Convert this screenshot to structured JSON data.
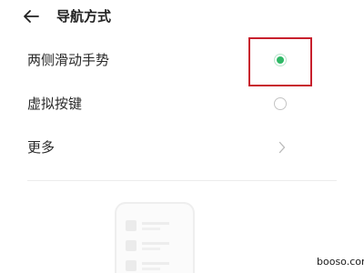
{
  "header": {
    "back_icon": "arrow-left-icon",
    "title": "导航方式"
  },
  "options": [
    {
      "label": "两侧滑动手势",
      "control": "radio",
      "selected": true,
      "color": "#2fb866"
    },
    {
      "label": "虚拟按键",
      "control": "radio",
      "selected": false
    },
    {
      "label": "更多",
      "control": "chevron-right-icon"
    }
  ],
  "annotation": {
    "box_color": "#c8202d"
  },
  "watermark": "booso.com"
}
